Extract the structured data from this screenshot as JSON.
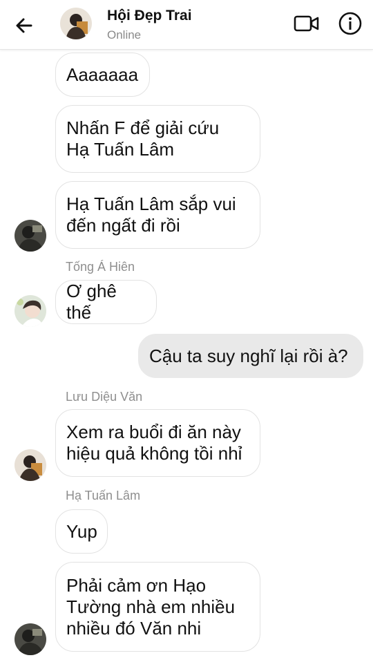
{
  "header": {
    "title": "Hội Đẹp Trai",
    "status": "Online",
    "icons": {
      "back": "arrow-left-icon",
      "video": "video-camera-icon",
      "info": "info-icon"
    }
  },
  "messages": [
    {
      "text": "Aaaaaaa",
      "direction": "incoming"
    },
    {
      "text": "Nhấn F để giải cứu\nHạ Tuấn Lâm",
      "direction": "incoming"
    },
    {
      "text": "Hạ Tuấn Lâm sắp vui\nđến ngất đi rồi",
      "direction": "incoming"
    },
    {
      "sender": "Tống Á Hiên",
      "text": "Ơ ghê thế",
      "direction": "incoming"
    },
    {
      "text": "Cậu ta suy nghĩ lại rồi à?",
      "direction": "outgoing"
    },
    {
      "sender": "Lưu Diệu Văn",
      "text": "Xem ra buổi đi ăn này\nhiệu quả không tồi nhỉ",
      "direction": "incoming"
    },
    {
      "sender": "Hạ Tuấn Lâm",
      "text": "Yup",
      "direction": "incoming"
    },
    {
      "text": "Phải cảm ơn Hạo\nTường nhà em nhiều\nnhiều đó Văn nhi",
      "direction": "incoming"
    }
  ]
}
